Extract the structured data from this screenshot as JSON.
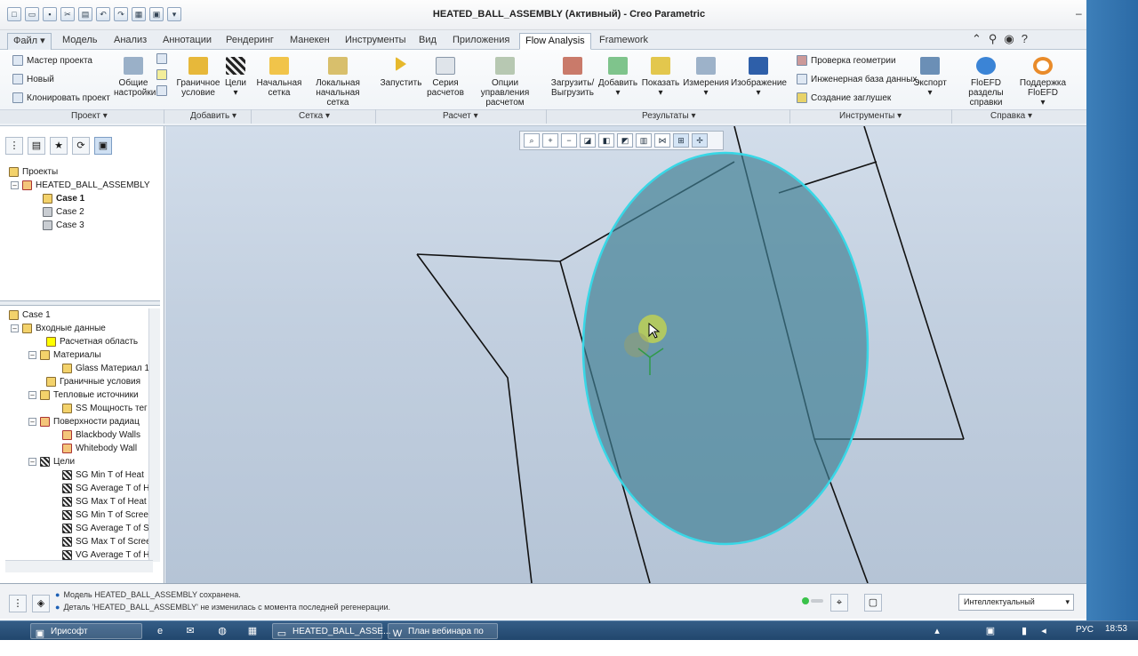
{
  "window": {
    "title": "HEATED_BALL_ASSEMBLY (Активный) - Creo Parametric"
  },
  "menu": {
    "file": "Файл ▾",
    "tabs": [
      "Модель",
      "Анализ",
      "Аннотации",
      "Рендеринг",
      "Манекен",
      "Инструменты",
      "Вид",
      "Приложения",
      "Flow Analysis",
      "Framework"
    ],
    "active": "Flow Analysis"
  },
  "ribbon": {
    "project_small": [
      "Мастер проекта",
      "Новый",
      "Клонировать проект"
    ],
    "general": "Общие настройки",
    "boundary": "Граничное условие",
    "goals": "Цели",
    "initial_mesh": "Начальная сетка",
    "local_mesh": "Локальная начальная сетка",
    "run": "Запустить",
    "batch": "Серия расчетов",
    "calc_options": "Опции управления расчетом",
    "load_unload": "Загрузить/ Выгрузить",
    "add": "Добавить",
    "show": "Показать",
    "measure": "Измерения",
    "image": "Изображение",
    "tools_small": [
      "Проверка геометрии",
      "Инженерная база данных",
      "Создание заглушек"
    ],
    "export": "Экспорт",
    "help_sections": "FloEFD разделы справки",
    "support": "Поддержка FloEFD",
    "groups": [
      "Проект ▾",
      "Добавить ▾",
      "Сетка ▾",
      "Расчет ▾",
      "Результаты ▾",
      "Инструменты ▾",
      "Справка ▾"
    ]
  },
  "projects_tree": {
    "root": "Проекты",
    "assembly": "HEATED_BALL_ASSEMBLY",
    "cases": [
      "Case 1",
      "Case 2",
      "Case 3"
    ]
  },
  "case_tree": {
    "root": "Case 1",
    "items": [
      {
        "label": "Входные данные",
        "level": 1
      },
      {
        "label": "Расчетная область",
        "level": 2
      },
      {
        "label": "Материалы",
        "level": 2
      },
      {
        "label": "Glass Материал 1",
        "level": 3
      },
      {
        "label": "Граничные условия",
        "level": 2
      },
      {
        "label": "Тепловые источники",
        "level": 2
      },
      {
        "label": "SS Мощность тег",
        "level": 3
      },
      {
        "label": "Поверхности радиац",
        "level": 2
      },
      {
        "label": "Blackbody Walls",
        "level": 3
      },
      {
        "label": "Whitebody Wall",
        "level": 3
      },
      {
        "label": "Цели",
        "level": 2
      },
      {
        "label": "SG Min T of Heat",
        "level": 3
      },
      {
        "label": "SG Average T of H",
        "level": 3
      },
      {
        "label": "SG Max T of Heat",
        "level": 3
      },
      {
        "label": "SG Min T of Scree",
        "level": 3
      },
      {
        "label": "SG Average T of S",
        "level": 3
      },
      {
        "label": "SG Max T of Scree",
        "level": 3
      },
      {
        "label": "VG Average T of H",
        "level": 3
      }
    ]
  },
  "status": {
    "messages": [
      "Модель HEATED_BALL_ASSEMBLY сохранена.",
      "Деталь 'HEATED_BALL_ASSEMBLY' не изменилась с момента последней регенерации."
    ],
    "filter": "Интеллектуальный"
  },
  "taskbar": {
    "start": "Ирисофт",
    "items": [
      "HEATED_BALL_ASSE...",
      "План вебинара по ..."
    ],
    "lang": "РУС",
    "time": "18:53"
  },
  "colors": {
    "accent": "#2b6aa6",
    "sphere_edge": "#38d7e6",
    "sphere_fill": "#3f7f94"
  }
}
